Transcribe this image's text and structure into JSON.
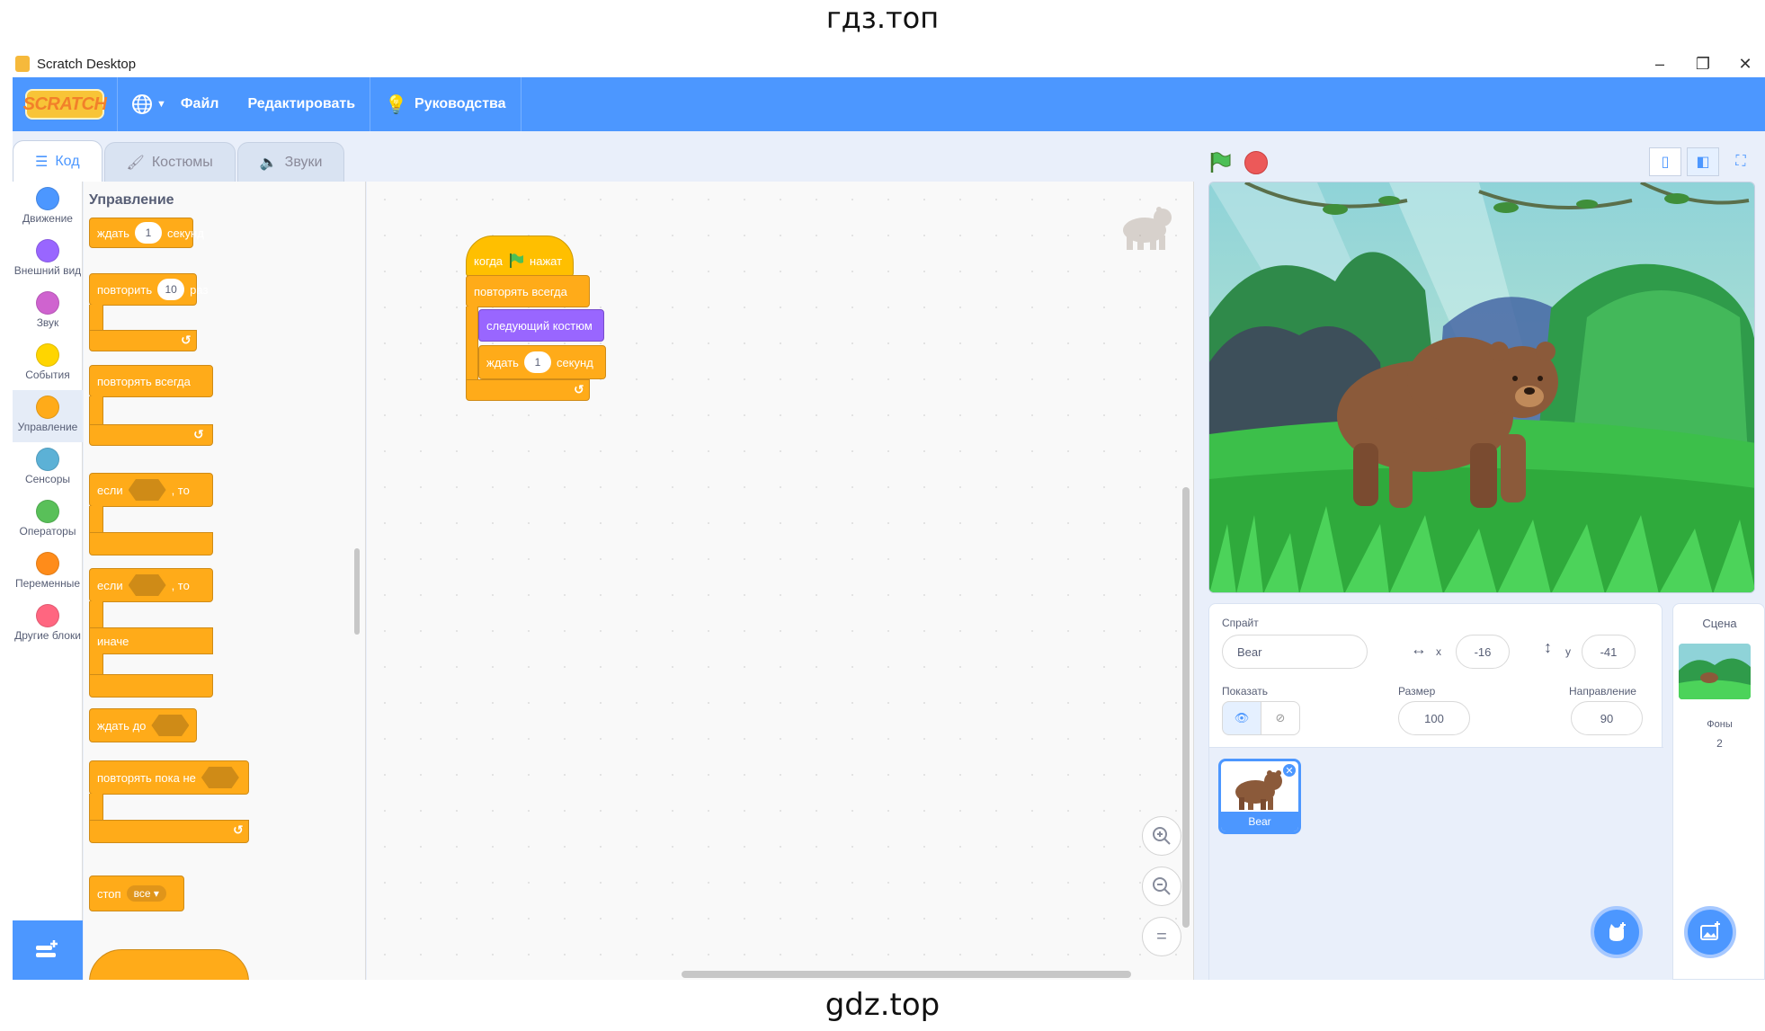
{
  "watermark": {
    "top": "гдз.топ",
    "bottom": "gdz.top"
  },
  "window": {
    "title": "Scratch Desktop",
    "minimize": "–",
    "restore": "❐",
    "close": "✕"
  },
  "menubar": {
    "logo": "SCRATCH",
    "file": "Файл",
    "edit": "Редактировать",
    "tutorials": "Руководства"
  },
  "tabs": {
    "code": "Код",
    "costumes": "Костюмы",
    "sounds": "Звуки"
  },
  "categories": [
    {
      "label": "Движение",
      "color": "#4c97ff"
    },
    {
      "label": "Внешний вид",
      "color": "#9966ff"
    },
    {
      "label": "Звук",
      "color": "#cf63cf"
    },
    {
      "label": "События",
      "color": "#ffd500"
    },
    {
      "label": "Управление",
      "color": "#ffab19"
    },
    {
      "label": "Сенсоры",
      "color": "#5cb1d6"
    },
    {
      "label": "Операторы",
      "color": "#59c059"
    },
    {
      "label": "Переменные",
      "color": "#ff8c1a"
    },
    {
      "label": "Другие блоки",
      "color": "#ff6680"
    }
  ],
  "palette": {
    "title": "Управление",
    "wait": {
      "prefix": "ждать",
      "value": "1",
      "suffix": "секунд"
    },
    "repeat": {
      "prefix": "повторить",
      "value": "10",
      "suffix": "раз"
    },
    "forever": "повторять всегда",
    "if_then": {
      "prefix": "если",
      "suffix": ", то"
    },
    "if_else": {
      "prefix": "если",
      "suffix": ", то",
      "else": "иначе"
    },
    "wait_until": "ждать до",
    "repeat_until": "повторять пока не",
    "stop": {
      "prefix": "стоп",
      "option": "все"
    }
  },
  "script": {
    "hat": {
      "prefix": "когда",
      "suffix": "нажат"
    },
    "forever": "повторять всегда",
    "next_costume": "следующий костюм",
    "wait": {
      "prefix": "ждать",
      "value": "1",
      "suffix": "секунд"
    }
  },
  "zoom": {
    "in": "+",
    "out": "−",
    "reset": "="
  },
  "sprite": {
    "label": "Спрайт",
    "name": "Bear",
    "x_label": "x",
    "x": "-16",
    "y_label": "y",
    "y": "-41",
    "show_label": "Показать",
    "size_label": "Размер",
    "size": "100",
    "direction_label": "Направление",
    "direction": "90",
    "thumb_name": "Bear"
  },
  "stage_pane": {
    "title": "Сцена",
    "backdrops_label": "Фоны",
    "backdrops_count": "2"
  },
  "colors": {
    "accent": "#4c97ff",
    "control": "#ffab19",
    "looks": "#9966ff"
  }
}
